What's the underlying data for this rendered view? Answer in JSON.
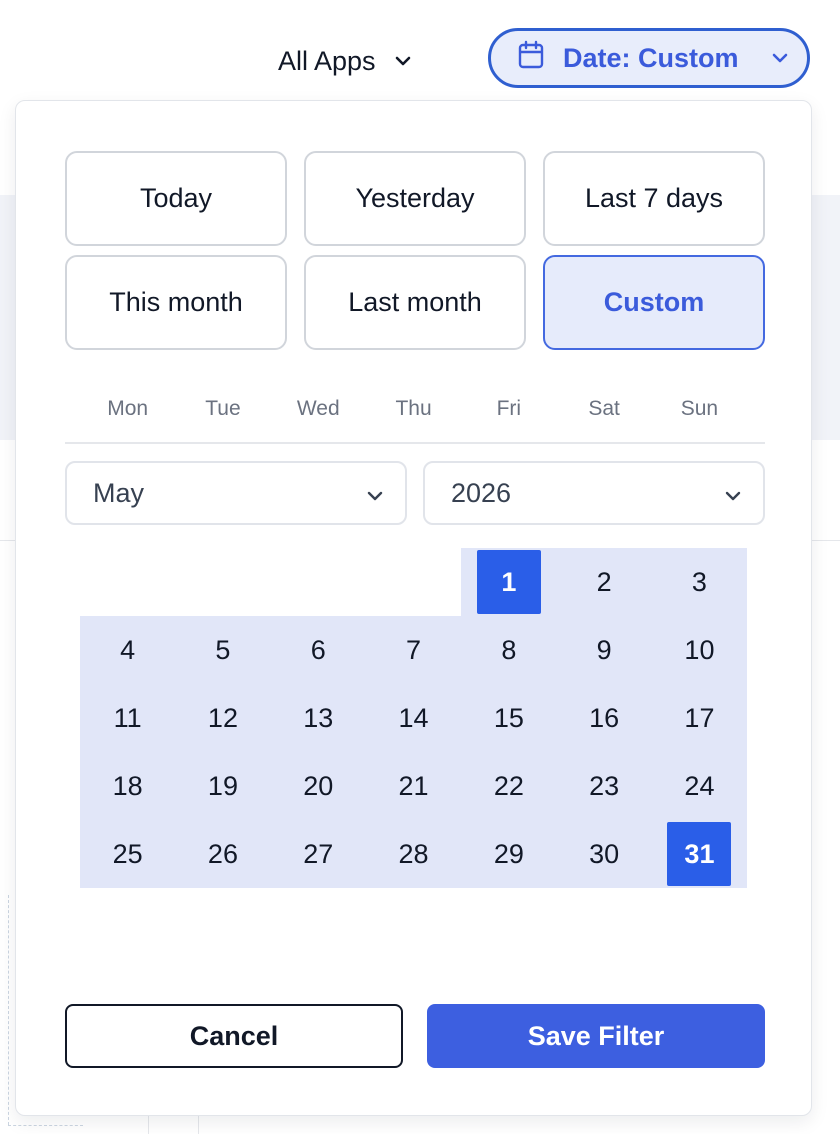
{
  "toolbar": {
    "apps_filter_label": "All Apps",
    "date_filter_label": "Date: Custom"
  },
  "presets": [
    {
      "label": "Today",
      "active": false
    },
    {
      "label": "Yesterday",
      "active": false
    },
    {
      "label": "Last 7 days",
      "active": false
    },
    {
      "label": "This month",
      "active": false
    },
    {
      "label": "Last month",
      "active": false
    },
    {
      "label": "Custom",
      "active": true
    }
  ],
  "weekdays": [
    "Mon",
    "Tue",
    "Wed",
    "Thu",
    "Fri",
    "Sat",
    "Sun"
  ],
  "month_select": {
    "value": "May"
  },
  "year_select": {
    "value": "2026"
  },
  "calendar": {
    "first_weekday_index": 4,
    "days_in_month": 31,
    "range_start": 1,
    "range_end": 31
  },
  "actions": {
    "cancel_label": "Cancel",
    "save_label": "Save Filter"
  },
  "colors": {
    "accent": "#3d5fe0",
    "selected_day": "#2a5ee8",
    "range_fill": "#e1e6f8"
  }
}
